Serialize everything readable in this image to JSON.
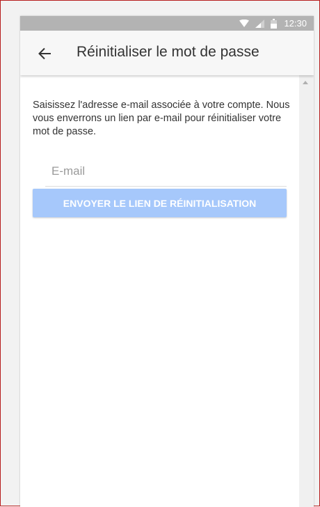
{
  "status_bar": {
    "time": "12:30",
    "icons": [
      "wifi-icon",
      "cell-signal-icon",
      "battery-icon"
    ]
  },
  "app_bar": {
    "back_icon": "arrow-left-icon",
    "title": "Réinitialiser le mot de passe"
  },
  "form": {
    "instructions": "Saisissez l'adresse e-mail associée à votre compte. Nous vous enverrons un lien par e-mail pour réinitialiser votre mot de passe.",
    "email_value": "",
    "email_placeholder": "E-mail",
    "submit_label": "ENVOYER LE LIEN DE RÉINITIALISATION"
  },
  "colors": {
    "status_bar": "#b3b3b3",
    "app_bar": "#f7f7f7",
    "button_disabled": "#a6c8fb",
    "frame_border": "#b71c1c"
  }
}
